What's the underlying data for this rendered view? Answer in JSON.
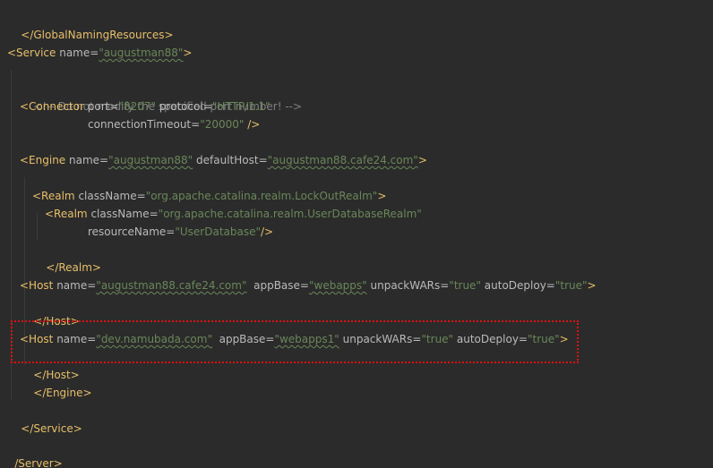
{
  "editor": {
    "lines": {
      "l1": {
        "close_tag": "</GlobalNamingResources>"
      },
      "l3": {
        "open": "<Service",
        "name_attr": " name=",
        "name_val": "\"augustman88\"",
        "close": ">"
      },
      "l5": {
        "comment": "<!-- Do not modify the specified port number! -->"
      },
      "l6": {
        "open": "<Connector",
        "port_attr": " port=",
        "port_val": "\"8207\"",
        "protocol_attr": " protocol=",
        "protocol_val": "\"HTTP/1.1\""
      },
      "l7": {
        "timeout_attr": "connectionTimeout=",
        "timeout_val": "\"20000\"",
        "close": " />"
      },
      "l9": {
        "open": "<Engine",
        "name_attr": " name=",
        "name_val": "\"augustman88\"",
        "host_attr": " defaultHost=",
        "host_val": "\"augustman88.cafe24.com\"",
        "close": ">"
      },
      "l11": {
        "open": "<Realm",
        "class_attr": " className=",
        "class_val": "\"org.apache.catalina.realm.LockOutRealm\"",
        "close": ">"
      },
      "l12": {
        "open": "<Realm",
        "class_attr": " className=",
        "class_val": "\"org.apache.catalina.realm.UserDatabaseRealm\""
      },
      "l13": {
        "res_attr": "resourceName=",
        "res_val": "\"UserDatabase\"",
        "close": "/>"
      },
      "l14": {
        "close_tag": "</Realm>"
      },
      "l16": {
        "open": "<Host",
        "name_attr": " name=",
        "name_val": "\"augustman88.cafe24.com\"",
        "appbase_attr": "  appBase=",
        "appbase_val": "\"webapps\"",
        "unpack_attr": " unpackWARs=",
        "unpack_val": "\"true\"",
        "deploy_attr": " autoDeploy=",
        "deploy_val": "\"true\"",
        "close": ">"
      },
      "l17": {
        "close_tag": "</Host>"
      },
      "l19": {
        "open": "<Host",
        "name_attr": " name=",
        "name_val": "\"dev.namubada.com\"",
        "appbase_attr": "  appBase=",
        "appbase_val": "\"webapps1\"",
        "unpack_attr": " unpackWARs=",
        "unpack_val": "\"true\"",
        "deploy_attr": " autoDeploy=",
        "deploy_val": "\"true\"",
        "close": ">"
      },
      "l20": {
        "close_tag": "</Host>"
      },
      "l21": {
        "close_tag": "</Engine>"
      },
      "l23": {
        "close_tag": "</Service>"
      },
      "l25": {
        "close_tag": "/Server>"
      }
    },
    "colors": {
      "background": "#2b2b2b",
      "tag": "#e8bf6a",
      "attribute": "#bababa",
      "value": "#6a8759",
      "comment": "#808080",
      "highlight_border": "#e01010"
    }
  }
}
